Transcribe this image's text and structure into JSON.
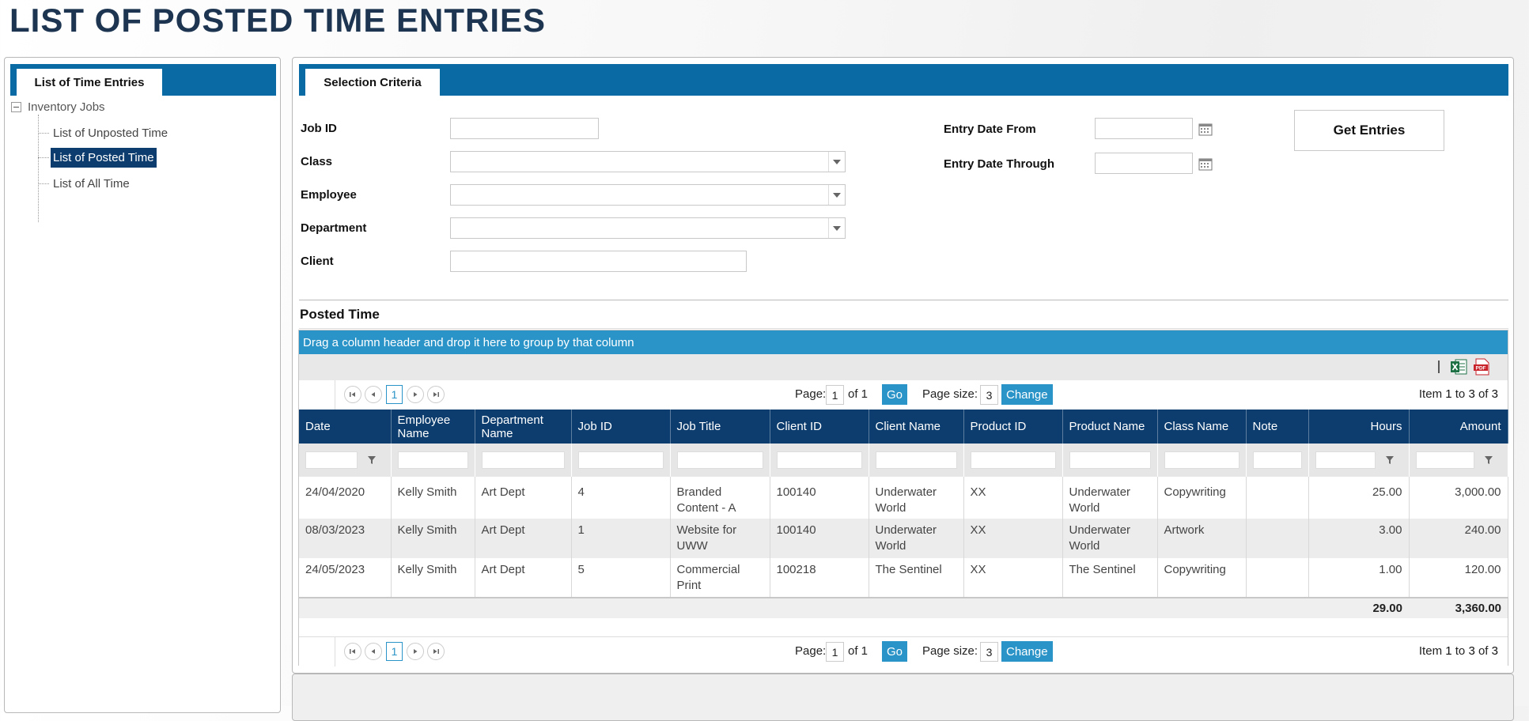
{
  "page": {
    "title": "LIST OF POSTED TIME ENTRIES"
  },
  "left_panel": {
    "tab_label": "List of Time Entries",
    "tree": {
      "root_label": "Inventory Jobs",
      "items": [
        {
          "label": "List of Unposted Time",
          "selected": false
        },
        {
          "label": "List of Posted Time",
          "selected": true
        },
        {
          "label": "List of All Time",
          "selected": false
        }
      ]
    }
  },
  "selection": {
    "tab_label": "Selection Criteria",
    "fields": {
      "job_id": {
        "label": "Job ID",
        "value": ""
      },
      "class": {
        "label": "Class",
        "value": ""
      },
      "employee": {
        "label": "Employee",
        "value": ""
      },
      "department": {
        "label": "Department",
        "value": ""
      },
      "client": {
        "label": "Client",
        "value": ""
      },
      "entry_date_from": {
        "label": "Entry Date From",
        "value": ""
      },
      "entry_date_through": {
        "label": "Entry Date Through",
        "value": ""
      }
    },
    "get_entries_label": "Get Entries"
  },
  "posted_time": {
    "section_title": "Posted Time",
    "group_hint": "Drag a column header and drop it here to group by that column",
    "pager": {
      "current_page": "1",
      "page_label": "Page:",
      "page_value": "1",
      "of_label": "of 1",
      "go_label": "Go",
      "page_size_label": "Page size:",
      "page_size_value": "3",
      "change_label": "Change",
      "item_prefix": "Item",
      "item_from": "1",
      "item_to_label": "to",
      "item_to": "3",
      "item_of_label": "of",
      "item_total": "3"
    },
    "columns": [
      "Date",
      "Employee Name",
      "Department Name",
      "Job ID",
      "Job Title",
      "Client ID",
      "Client Name",
      "Product ID",
      "Product Name",
      "Class Name",
      "Note",
      "Hours",
      "Amount"
    ],
    "rows": [
      [
        "24/04/2020",
        "Kelly Smith",
        "Art Dept",
        "4",
        "Branded Content - A",
        "100140",
        "Underwater World",
        "XX",
        "Underwater World",
        "Copywriting",
        "",
        "25.00",
        "3,000.00"
      ],
      [
        "08/03/2023",
        "Kelly Smith",
        "Art Dept",
        "1",
        "Website for UWW",
        "100140",
        "Underwater World",
        "XX",
        "Underwater World",
        "Artwork",
        "",
        "3.00",
        "240.00"
      ],
      [
        "24/05/2023",
        "Kelly Smith",
        "Art Dept",
        "5",
        "Commercial Print",
        "100218",
        "The Sentinel",
        "XX",
        "The Sentinel",
        "Copywriting",
        "",
        "1.00",
        "120.00"
      ]
    ],
    "totals": {
      "hours": "29.00",
      "amount": "3,360.00"
    }
  },
  "colors": {
    "title": "#1d3550",
    "tab_bar": "#0a6aa3",
    "header_dark": "#0d3d6e",
    "accent_blue": "#2a93c7",
    "excel_green": "#1e7145",
    "pdf_red": "#c8232b"
  },
  "icons": [
    "calendar-icon",
    "dropdown-arrow-icon",
    "filter-icon",
    "excel-export-icon",
    "pdf-export-icon",
    "first-page-icon",
    "prev-page-icon",
    "next-page-icon",
    "last-page-icon",
    "tree-collapse-icon"
  ]
}
